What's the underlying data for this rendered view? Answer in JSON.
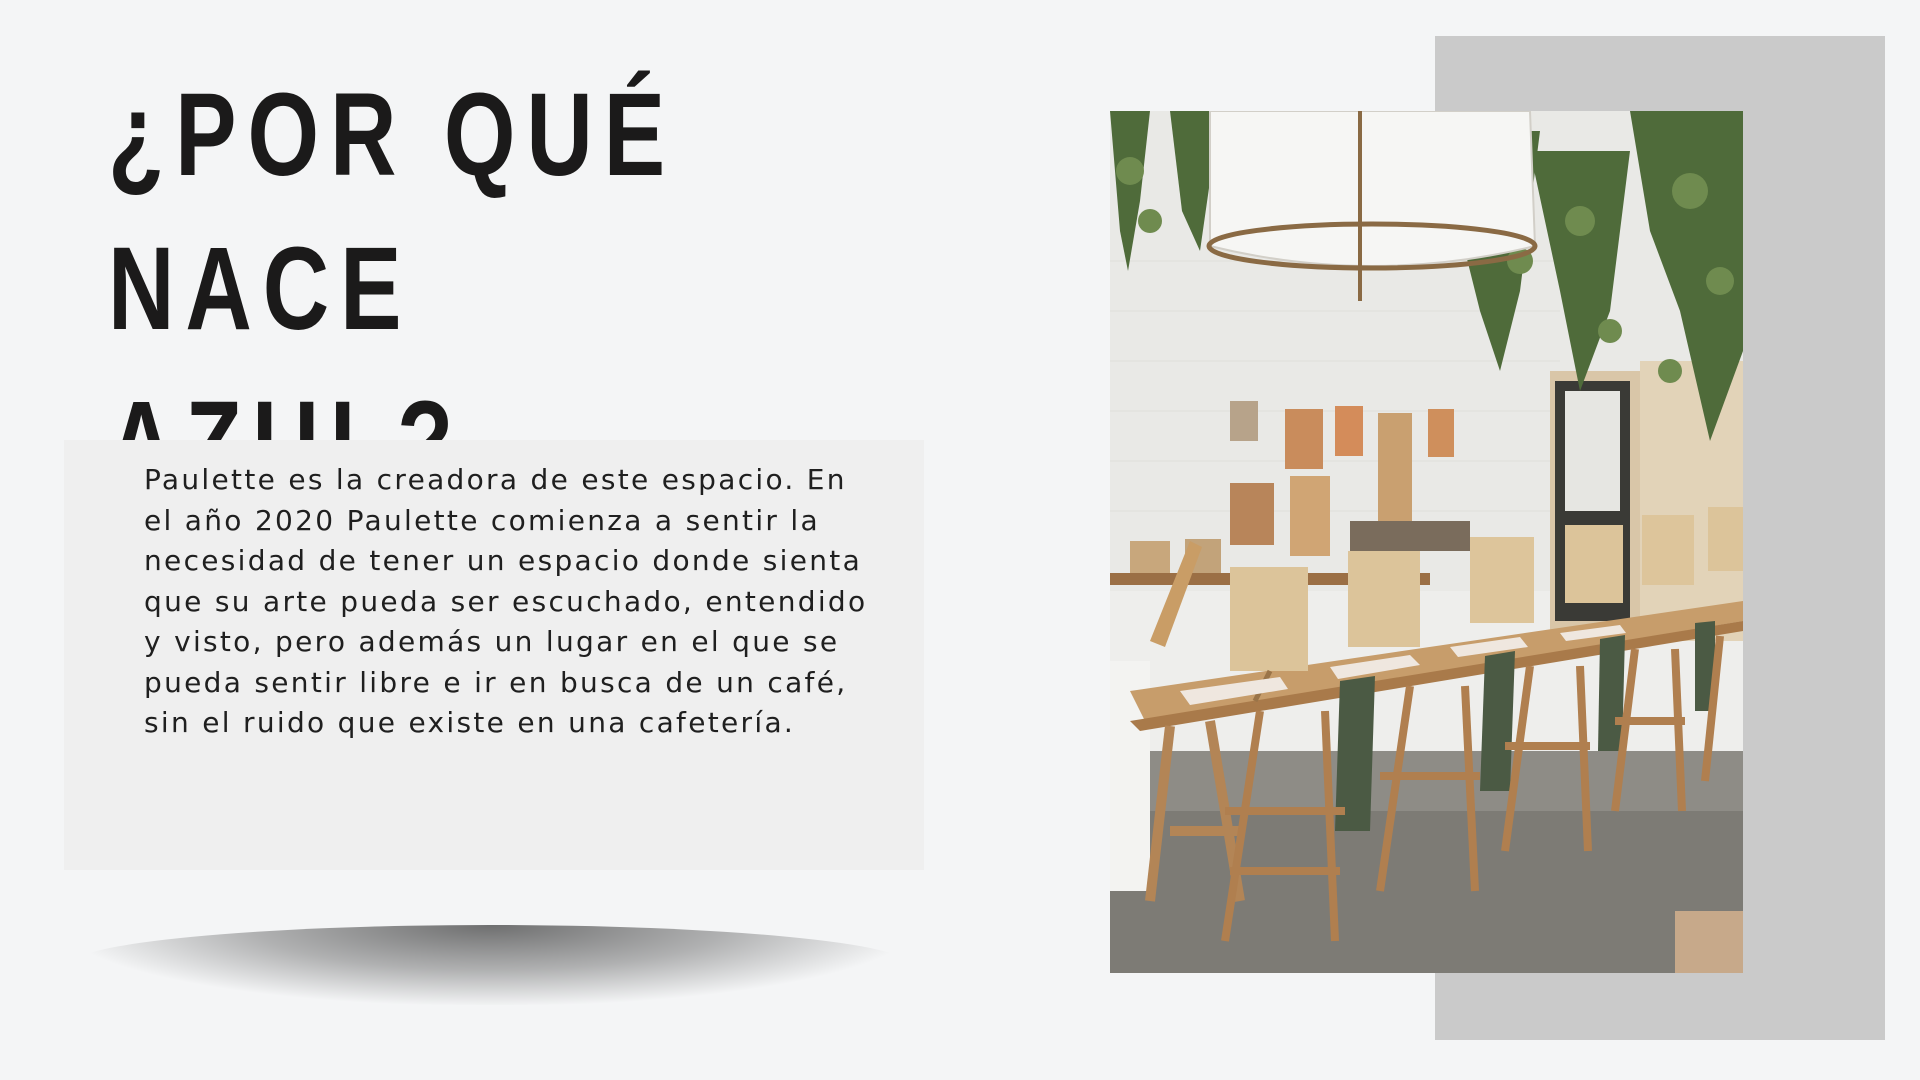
{
  "slide": {
    "title_line1": "¿POR QUÉ NACE",
    "title_line2": "AZUL?",
    "body": "Paulette es la creadora de este espacio. En el año 2020 Paulette comienza a sentir la necesidad de tener un espacio donde sienta que su arte pueda ser escuchado, entendido y visto, pero además un lugar en el que se pueda sentir libre e ir en busca de un café, sin el ruido que existe en una cafetería."
  },
  "colors": {
    "background": "#f4f5f6",
    "title": "#1b1a1a",
    "panel": "#efefef",
    "accent_rect": "#cacaca"
  }
}
